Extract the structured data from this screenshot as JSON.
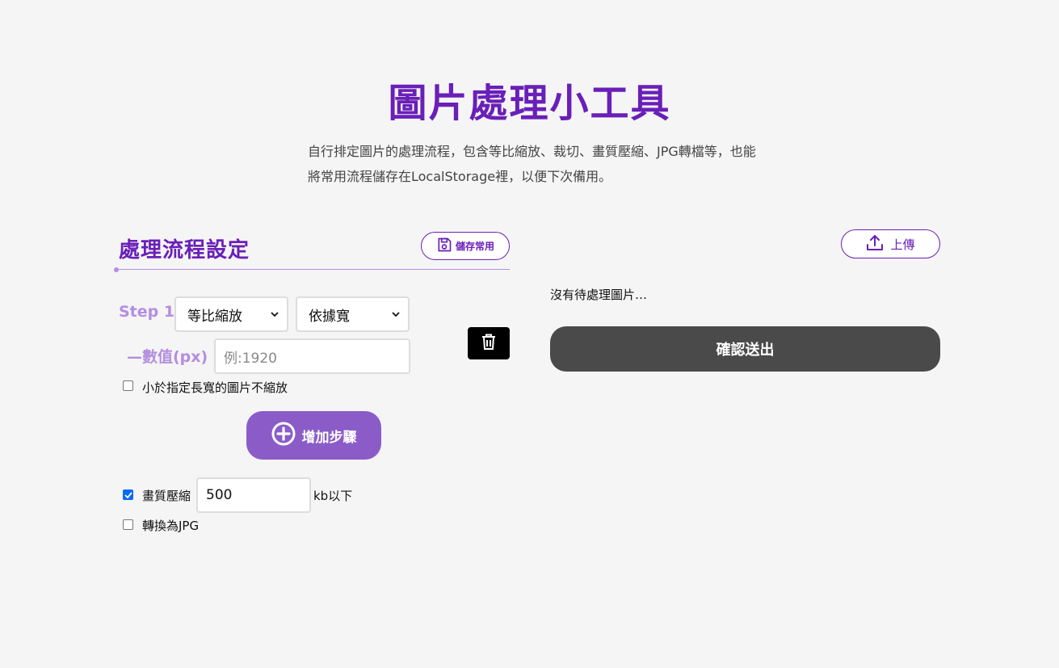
{
  "header": {
    "title": "圖片處理小工具",
    "description": "自行排定圖片的處理流程，包含等比縮放、裁切、畫質壓縮、JPG轉檔等，也能將常用流程儲存在LocalStorage裡，以便下次備用。"
  },
  "workflow": {
    "title": "處理流程設定",
    "save_label": "儲存常用",
    "step": {
      "label": "Step 1",
      "operation": "等比縮放",
      "mode": "依據寬",
      "value_label": "—數值(px)",
      "value_placeholder": "例:1920",
      "no_upscale_label": "小於指定長寬的圖片不縮放",
      "no_upscale_checked": false
    },
    "add_step_label": "增加步驟",
    "quality": {
      "label": "畫質壓縮",
      "checked": true,
      "value": "500",
      "unit": "kb以下"
    },
    "jpg": {
      "label": "轉換為JPG",
      "checked": false
    }
  },
  "uploader": {
    "upload_label": "上傳",
    "empty_message": "沒有待處理圖片…",
    "submit_label": "確認送出"
  },
  "colors": {
    "accent": "#6a1fb8",
    "accent_light": "#b48ee0",
    "add_button": "#8b5cc8",
    "submit_button": "#4a4a4a",
    "checkbox_checked": "#0b6bf0"
  },
  "icons": {
    "save": "floppy-disk-icon",
    "delete": "trash-icon",
    "add": "plus-circle-icon",
    "upload": "upload-icon"
  }
}
